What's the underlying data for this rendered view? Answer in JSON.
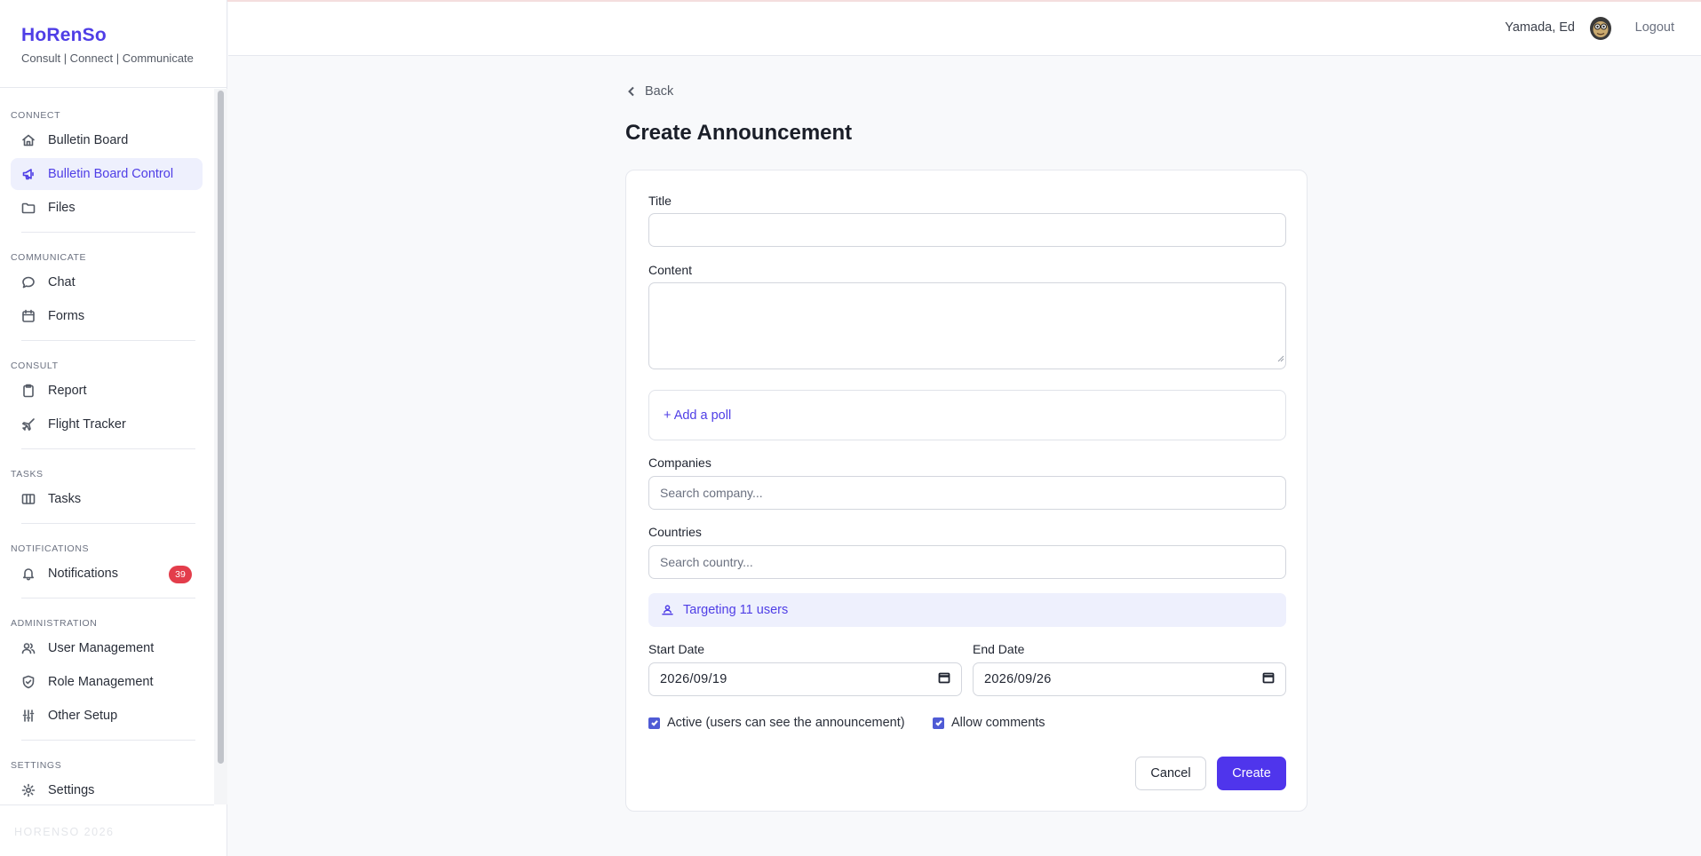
{
  "app": {
    "brand_title": "HoRenSo",
    "brand_subtitle": "Consult | Connect | Communicate",
    "footer_brand": "HORENSO 2026"
  },
  "sidebar": {
    "sections": [
      {
        "label": "Connect",
        "items": [
          {
            "label": "Bulletin Board",
            "icon": "home-icon"
          },
          {
            "label": "Bulletin Board Control",
            "icon": "megaphone-icon",
            "active": true
          },
          {
            "label": "Files",
            "icon": "folder-icon"
          }
        ]
      },
      {
        "label": "Communicate",
        "items": [
          {
            "label": "Chat",
            "icon": "chat-bubble-icon"
          },
          {
            "label": "Forms",
            "icon": "calendar-icon"
          }
        ]
      },
      {
        "label": "Consult",
        "items": [
          {
            "label": "Report",
            "icon": "clipboard-icon"
          },
          {
            "label": "Flight Tracker",
            "icon": "plane-icon"
          }
        ]
      },
      {
        "label": "Tasks",
        "items": [
          {
            "label": "Tasks",
            "icon": "columns-icon"
          }
        ]
      },
      {
        "label": "Notifications",
        "items": [
          {
            "label": "Notifications",
            "icon": "bell-icon",
            "badge": "39"
          }
        ]
      },
      {
        "label": "Administration",
        "items": [
          {
            "label": "User Management",
            "icon": "users-icon"
          },
          {
            "label": "Role Management",
            "icon": "shield-icon"
          },
          {
            "label": "Other Setup",
            "icon": "sliders-icon"
          }
        ]
      },
      {
        "label": "Settings",
        "items": [
          {
            "label": "Settings",
            "icon": "gear-icon"
          }
        ]
      }
    ]
  },
  "header": {
    "user_name": "Yamada, Ed",
    "logout_label": "Logout"
  },
  "main": {
    "back_label": "Back",
    "page_title": "Create Announcement",
    "form": {
      "title_label": "Title",
      "title_value": "",
      "content_label": "Content",
      "content_value": "",
      "add_poll_label": "+ Add a poll",
      "companies_label": "Companies",
      "companies_placeholder": "Search company...",
      "countries_label": "Countries",
      "countries_placeholder": "Search country...",
      "targeting_text": "Targeting 11 users",
      "start_date_label": "Start Date",
      "start_date_value": "2026/09/19",
      "end_date_label": "End Date",
      "end_date_value": "2026/09/26",
      "active_label": "Active (users can see the announcement)",
      "active_checked": true,
      "allow_comments_label": "Allow comments",
      "allow_comments_checked": true,
      "cancel_label": "Cancel",
      "create_label": "Create"
    }
  },
  "colors": {
    "accent": "#4f3ee6",
    "primary_button": "#4f35ec",
    "badge": "#e33d4b",
    "active_bg": "#eef0fd"
  }
}
